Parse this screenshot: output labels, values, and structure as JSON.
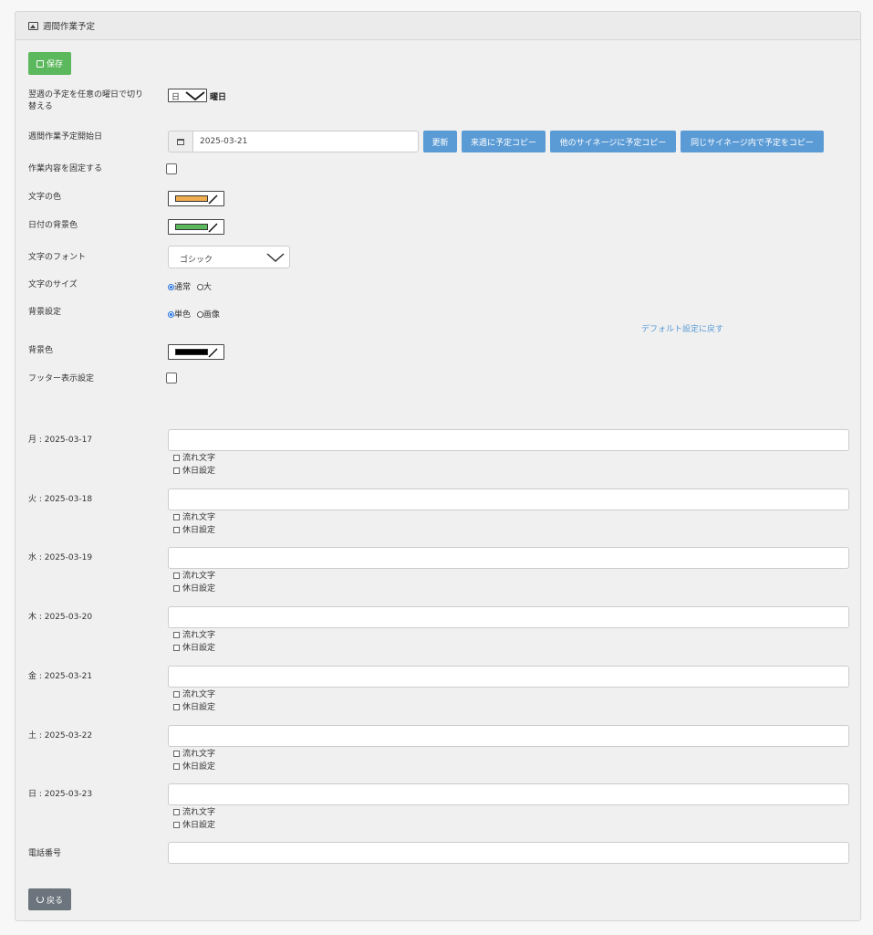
{
  "panel": {
    "title": "週間作業予定"
  },
  "toolbar": {
    "save_label": "保存",
    "back_label": "戻る"
  },
  "switch_day": {
    "label_line1": "翌週の予定を任意の曜日で切り",
    "label_line2": "替える",
    "selected": "日",
    "suffix": "曜日"
  },
  "start_date": {
    "label": "週間作業予定開始日",
    "value": "2025-03-21",
    "update_label": "更新",
    "copy_next_week_label": "来週に予定コピー",
    "copy_other_signage_label": "他のサイネージに予定コピー",
    "copy_same_signage_label": "同じサイネージ内で予定をコピー"
  },
  "fix_content": {
    "label": "作業内容を固定する",
    "checked": false
  },
  "text_color": {
    "label": "文字の色",
    "color": "#f0ad4e"
  },
  "date_bg_color": {
    "label": "日付の背景色",
    "color": "#5cb85c"
  },
  "font": {
    "label": "文字のフォント",
    "selected": "ゴシック"
  },
  "size": {
    "label": "文字のサイズ",
    "option_normal": "通常",
    "option_large": "大",
    "selected": "通常"
  },
  "background": {
    "label": "背景設定",
    "option_solid": "単色",
    "option_image": "画像",
    "selected": "単色",
    "reset_link": "デフォルト設定に戻す",
    "color_label": "背景色",
    "color": "#000000"
  },
  "footer": {
    "label": "フッター表示設定",
    "checked": false
  },
  "days": [
    {
      "label": "月 : 2025-03-17",
      "scroll_label": "流れ文字",
      "holiday_label": "休日設定",
      "value": ""
    },
    {
      "label": "火 : 2025-03-18",
      "scroll_label": "流れ文字",
      "holiday_label": "休日設定",
      "value": ""
    },
    {
      "label": "水 : 2025-03-19",
      "scroll_label": "流れ文字",
      "holiday_label": "休日設定",
      "value": ""
    },
    {
      "label": "木 : 2025-03-20",
      "scroll_label": "流れ文字",
      "holiday_label": "休日設定",
      "value": ""
    },
    {
      "label": "金 : 2025-03-21",
      "scroll_label": "流れ文字",
      "holiday_label": "休日設定",
      "value": ""
    },
    {
      "label": "土 : 2025-03-22",
      "scroll_label": "流れ文字",
      "holiday_label": "休日設定",
      "value": ""
    },
    {
      "label": "日 : 2025-03-23",
      "scroll_label": "流れ文字",
      "holiday_label": "休日設定",
      "value": ""
    }
  ],
  "phone": {
    "label": "電話番号",
    "value": ""
  }
}
